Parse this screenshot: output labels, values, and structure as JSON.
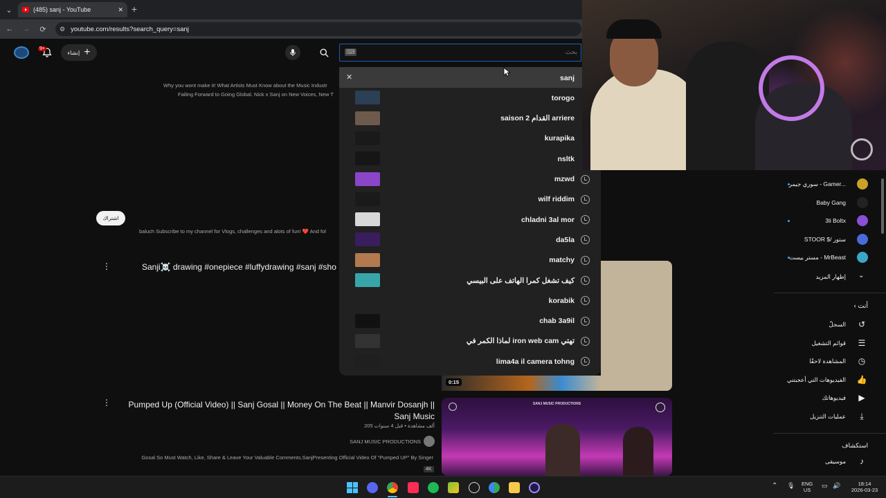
{
  "browser": {
    "tab_title": "(485) sanj - YouTube",
    "tab_close": "✕",
    "new_tab": "+",
    "url": "youtube.com/results?search_query=sanj",
    "back": "←",
    "forward": "→",
    "reload": "⟳",
    "menu": "⌄"
  },
  "header": {
    "notif_count": "9+",
    "create_label": "إنشاء",
    "search_placeholder": "بحث",
    "search_kbd": "⌨"
  },
  "search_dropdown": {
    "close": "✕",
    "suggestions": [
      {
        "text": "sanj",
        "history": false
      },
      {
        "text": "torogo",
        "history": false
      },
      {
        "text": "saison 2 القدام arriere",
        "history": false
      },
      {
        "text": "kurapika",
        "history": false
      },
      {
        "text": "nsltk",
        "history": false
      },
      {
        "text": "mzwd",
        "history": true
      },
      {
        "text": "wilf riddim",
        "history": true
      },
      {
        "text": "chladni 3al mor",
        "history": true
      },
      {
        "text": "da5la",
        "history": true
      },
      {
        "text": "matchy",
        "history": true
      },
      {
        "text": "كيف تشغل كمرا الهاتف على البيسي",
        "history": true
      },
      {
        "text": "korabik",
        "history": true
      },
      {
        "text": "chab 3a9il",
        "history": true
      },
      {
        "text": "لماذا الكمر في iron web cam تهتي",
        "history": true
      },
      {
        "text": "lima4a il camera tohng",
        "history": true
      }
    ]
  },
  "results": {
    "snippet1_line1": "Why you wont make it! What Artists Must Know about the Music Industr",
    "snippet1_line2": "Failing Forward to Going Global. Nick x Sanj on New Voices, New T",
    "subscribe_btn": "اشتراك",
    "snippet2": "baluch Subscribe to my channel for Vlogs, challenges and alots of fun! ❤️ And fol",
    "short_title": "Sanji☠️ drawing #onepiece #luffydrawing #sanj #sho",
    "duration1": "0:15",
    "video2_title": "Pumped Up (Official Video) || Sanj Gosal || Money On The Beat || Manvir Dosanjh || Sanj Music",
    "video2_meta": "205 ألف مشاهدة • قبل 4 سنوات",
    "video2_channel": "SANJ MUSIC PRODUCTIONS",
    "video2_desc": "Gosal So Must Watch, Like, Share & Leave Your Valuable Comments.SanjPresenting Official Video Of \"Pumped UP\" By Singer",
    "video2_badge": "4K",
    "thumb_caption": "SANJ MUSIC PRODUCTIONS"
  },
  "sidebar": {
    "subs": [
      {
        "label": "سوري جيمر - Gamer...",
        "dot": true
      },
      {
        "label": "Baby Gang",
        "dot": false
      },
      {
        "label": "3li Boltx",
        "dot": true
      },
      {
        "label": "STOOR $/ ستور",
        "dot": false
      },
      {
        "label": "مستر بيست - MrBeast",
        "dot": true
      }
    ],
    "show_more": "إظهار المزيد",
    "you_label": "أنت",
    "items": [
      {
        "label": "السجلّ",
        "icon": "history-icon"
      },
      {
        "label": "قوائم التشغيل",
        "icon": "playlist-icon"
      },
      {
        "label": "المشاهدة لاحقًا",
        "icon": "clock-icon"
      },
      {
        "label": "الفيديوهات التي أعجبتني",
        "icon": "thumb-up-icon"
      },
      {
        "label": "فيديوهاتك",
        "icon": "video-icon"
      },
      {
        "label": "عمليات التنزيل",
        "icon": "download-icon"
      }
    ],
    "explore_label": "استكشاف",
    "music_label": "موسيقى"
  },
  "taskbar": {
    "lang_top": "ENG",
    "lang_bottom": "US",
    "time": "18:14",
    "date": "2026-03-23",
    "chevron": "⌃"
  },
  "colors": {
    "yt_red": "#ff0000",
    "focus_blue": "#1c62b9",
    "link_blue": "#3ea6ff"
  }
}
